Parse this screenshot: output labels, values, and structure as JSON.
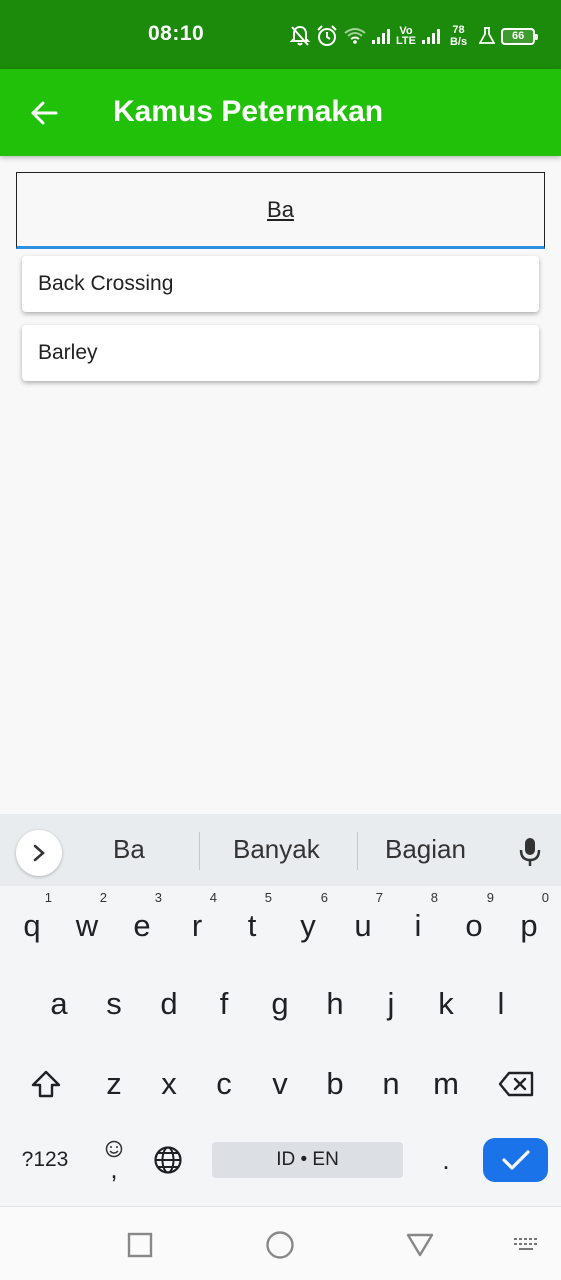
{
  "status_bar": {
    "time": "08:10",
    "icons": [
      "notifications-off-icon",
      "alarm-icon",
      "wifi-icon",
      "signal-icon",
      "signal-icon",
      "flask-icon"
    ],
    "volte_top": "Vo",
    "volte_bottom": "LTE",
    "speed_value": "78",
    "speed_unit": "B/s",
    "battery": "66"
  },
  "app_bar": {
    "back_icon": "arrow-left-icon",
    "title": "Kamus Peternakan",
    "background": "#21c10a"
  },
  "search": {
    "value": "Ba"
  },
  "suggestions": [
    {
      "label": "Back Crossing"
    },
    {
      "label": "Barley"
    }
  ],
  "keyboard": {
    "word_suggestions": [
      "Ba",
      "Banyak",
      "Bagian"
    ],
    "row1": [
      {
        "key": "q",
        "hint": "1"
      },
      {
        "key": "w",
        "hint": "2"
      },
      {
        "key": "e",
        "hint": "3"
      },
      {
        "key": "r",
        "hint": "4"
      },
      {
        "key": "t",
        "hint": "5"
      },
      {
        "key": "y",
        "hint": "6"
      },
      {
        "key": "u",
        "hint": "7"
      },
      {
        "key": "i",
        "hint": "8"
      },
      {
        "key": "o",
        "hint": "9"
      },
      {
        "key": "p",
        "hint": "0"
      }
    ],
    "row2": [
      "a",
      "s",
      "d",
      "f",
      "g",
      "h",
      "j",
      "k",
      "l"
    ],
    "row3": [
      "z",
      "x",
      "c",
      "v",
      "b",
      "n",
      "m"
    ],
    "symbols_label": "?123",
    "comma_label": ",",
    "space_label": "ID • EN",
    "period_label": ".",
    "enter_color": "#1a73e8"
  },
  "nav_bar": {
    "icons": [
      "recent-apps-icon",
      "home-icon",
      "back-icon",
      "keyboard-switch-icon"
    ]
  }
}
